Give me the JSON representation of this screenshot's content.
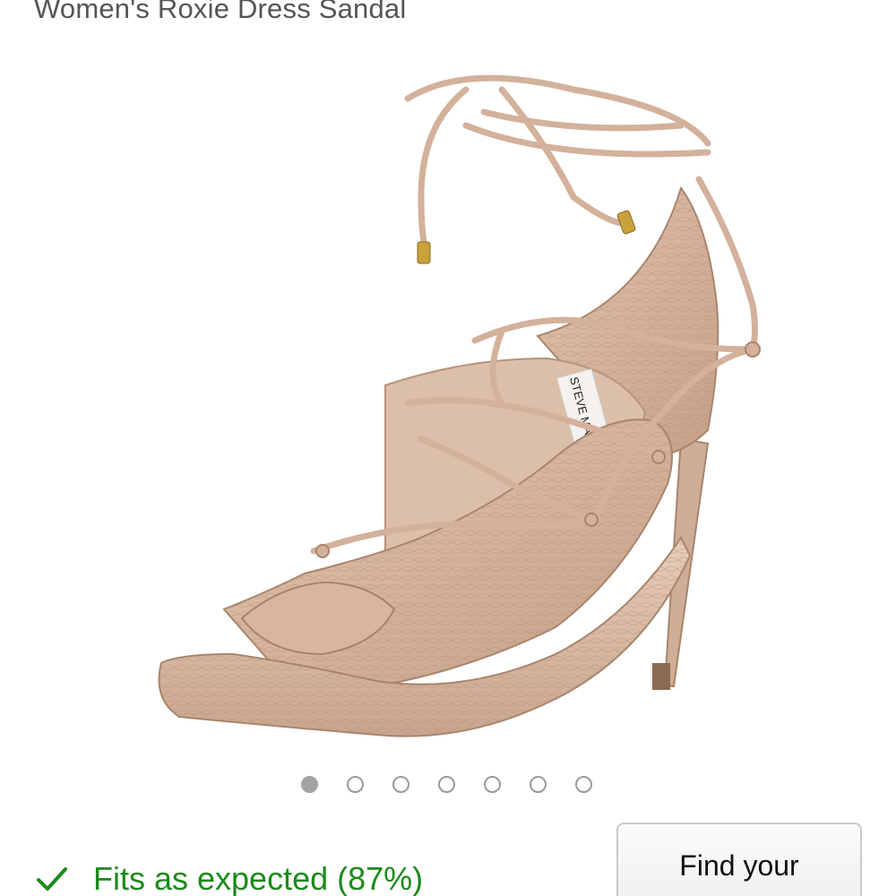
{
  "product": {
    "title": "Women's Roxie Dress Sandal",
    "image_label": "STEVE MADDEN"
  },
  "carousel": {
    "dot_count": 7,
    "active_index": 0
  },
  "fit": {
    "icon": "checkmark-icon",
    "text": "Fits as expected (87%)",
    "color": "#1b8a1b"
  },
  "find_size": {
    "label": "Find your"
  },
  "colors": {
    "sandal": "#d9b9a3",
    "sandal_shadow": "#b9957f",
    "heel": "#cfae97"
  }
}
